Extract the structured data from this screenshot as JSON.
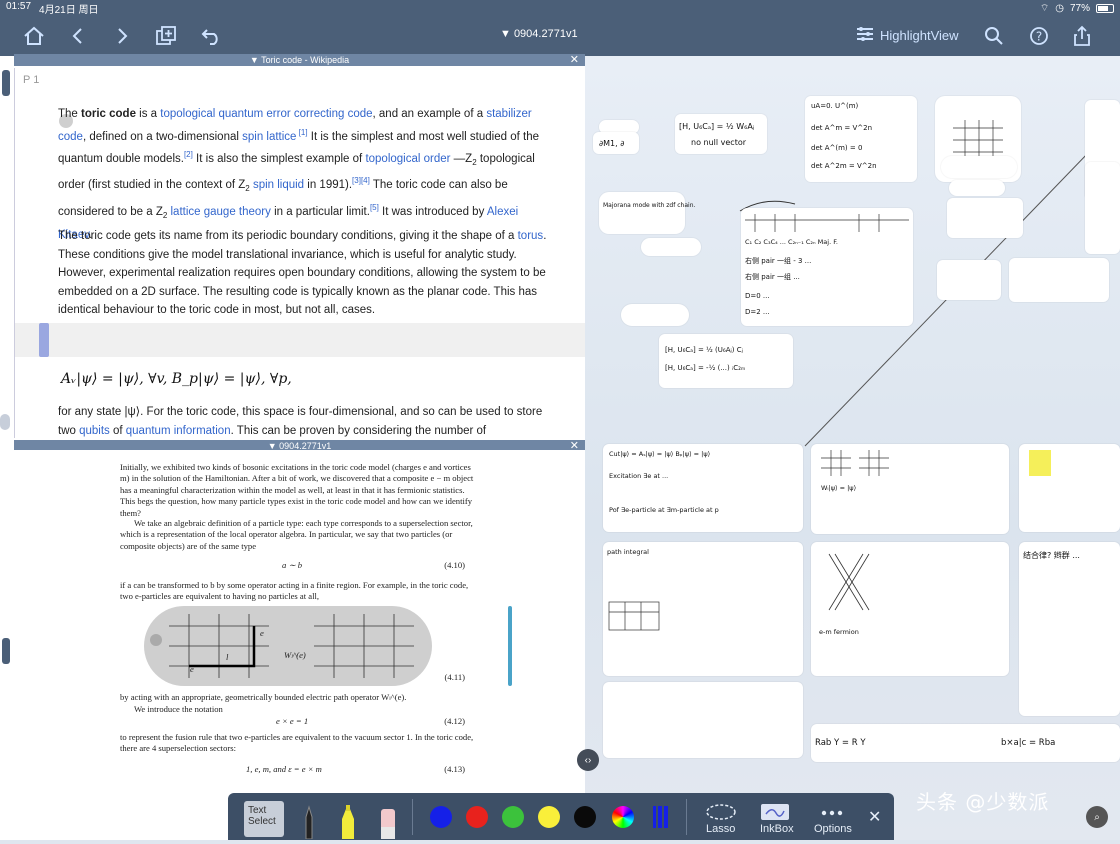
{
  "status": {
    "time": "01:57",
    "date": "4月21日 周日",
    "battery": "77%"
  },
  "nav": {
    "document_title": "▼ 0904.2771v1",
    "highlight_view": "HighlightView"
  },
  "wiki_pane": {
    "header": "▼ Toric code - Wikipedia",
    "page_label": "P 1",
    "p1_html_parts": [
      "The ",
      "toric code",
      " is a ",
      "topological quantum error correcting code",
      ", and an example of a ",
      "stabilizer code",
      ", defined on a two-dimensional ",
      "spin lattice",
      " [1]",
      " It is the simplest and most well studied of the quantum double models.",
      "[2]",
      " It is also the simplest example of ",
      "topological order",
      " —Z",
      "2",
      " topological order (first studied in the context of Z",
      "2",
      " ",
      "spin liquid",
      " in 1991).",
      "[3][4]",
      " The toric code can also be considered to be a Z",
      "2",
      " ",
      "lattice gauge theory",
      " in a particular limit.",
      "[5]",
      " It was introduced by ",
      "Alexei Kitaev",
      "."
    ],
    "p2_a": "The toric code gets its name from its periodic boundary conditions, giving it the shape of a ",
    "p2_link": "torus",
    "p2_b": ". These conditions give the model translational invariance, which is useful for analytic study. However, experimental realization requires open boundary conditions, allowing the system to be embedded on a 2D surface. The resulting code is typically known as the planar code. This has identical behaviour to the toric code in most, but not all, cases.",
    "equation": "Aᵥ|ψ⟩ = |ψ⟩, ∀v, B_p|ψ⟩ = |ψ⟩, ∀p,",
    "p3_a": "for any state |ψ⟩. For the toric code, this space is four-dimensional, and so can be used to store two ",
    "p3_link1": "qubits",
    "p3_mid": " of ",
    "p3_link2": "quantum information",
    "p3_b": ". This can be proven by considering the number of"
  },
  "paper_pane": {
    "header": "▼ 0904.2771v1",
    "para1": "Initially, we exhibited two kinds of bosonic excitations in the toric code model (charges e and vortices m) in the solution of the Hamiltonian. After a bit of work, we discovered that a composite e − m object has a meaningful characterization within the model as well, at least in that it has fermionic statistics. This begs the question, how many particle types exist in the toric code model and how can we identify them?",
    "para2": "We take an algebraic definition of a particle type: each type corresponds to a superselection sector, which is a representation of the local operator algebra. In particular, we say that two particles (or composite objects) are of the same type",
    "eq410": "a ∼ b",
    "eq410_num": "(4.10)",
    "para3": "if a can be transformed to b by some operator acting in a finite region. For example, in the toric code, two e-particles are equivalent to having no particles at all,",
    "eq411_num": "(4.11)",
    "para4": "by acting with an appropriate, geometrically bounded electric path operator Wₗ^(e).",
    "para5": "We introduce the notation",
    "eq412": "e × e = 1",
    "eq412_num": "(4.12)",
    "para6": "to represent the fusion rule that two e-particles are equivalent to the vacuum sector 1. In the toric code, there are 4 superselection sectors:",
    "eq413": "1, e, m, and ε = e × m",
    "eq413_num": "(4.13)",
    "fig_label_e": "e",
    "fig_label_e2": "e",
    "fig_label_l": "l",
    "fig_label_w": "Wₗ^(e)"
  },
  "canvas_notes": {
    "n1": "∂M1, ∂",
    "n2": "[H, U₆Cₐ] = ½ W₆Aⱼ",
    "n3": "no null vector",
    "n4": "Aₛ|ψ⟩ = |ψ⟩   Bₚ|ψ⟩ = |ψ⟩",
    "n5": "Majorana mode with zdf chain.",
    "n6": "C₁ C₂ C₃C₄ ... C₂ₙ₋₁ C₂ₙ   Maj. F.",
    "n7": "[H, U₆Cₐ] = ½ (U₆Aⱼ) Cⱼ",
    "n8": "Cut|ψ⟩ = Aₛ|ψ⟩ = |ψ⟩   Bₚ|ψ⟩ = |ψ⟩",
    "n9": "Wₗ|ψ⟩ = |ψ⟩",
    "n10": "e-m fermion",
    "n11": "Rab  Y  =  R  Y",
    "n12": "b×a|c = Rba",
    "n13": "path integral"
  },
  "toolbar": {
    "text_select": "Text\nSelect",
    "lasso": "Lasso",
    "inkbox": "InkBox",
    "options": "Options",
    "colors": [
      "#1520e8",
      "#e8221d",
      "#3cc23c",
      "#f9ef3a",
      "#0a0a0a"
    ]
  },
  "watermark": "头条 @少数派"
}
